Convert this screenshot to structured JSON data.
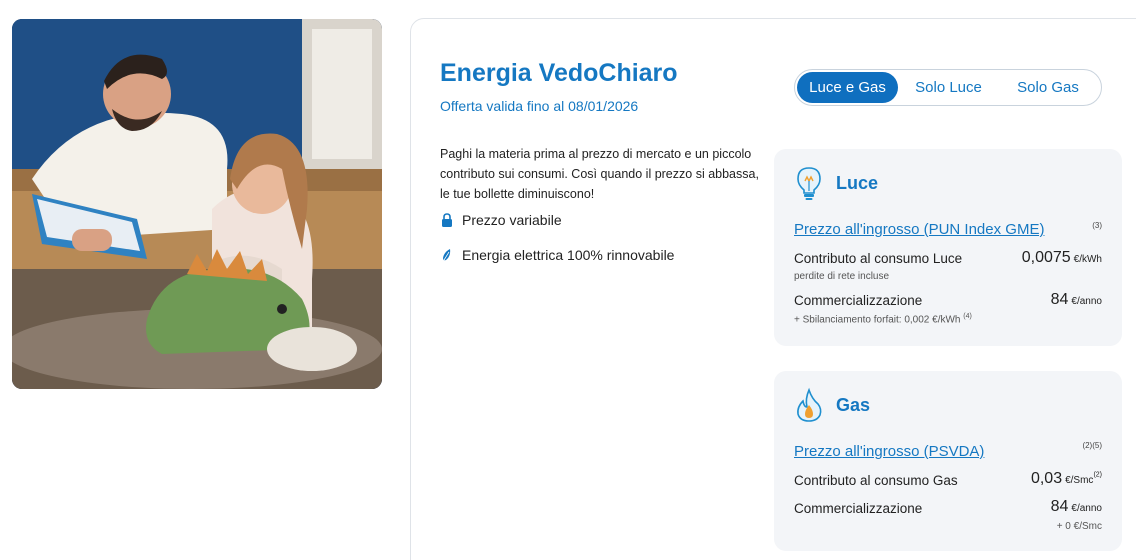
{
  "offer": {
    "title": "Energia VedoChiaro",
    "validity": "Offerta valida fino al 08/01/2026",
    "description": "Paghi la materia prima al prezzo di mercato e un piccolo contributo sui consumi. Così quando il prezzo si abbassa, le tue bollette diminuiscono!",
    "features": [
      {
        "icon": "lock-icon",
        "label": "Prezzo variabile"
      },
      {
        "icon": "leaf-icon",
        "label": "Energia elettrica 100% rinnovabile"
      }
    ]
  },
  "tabs": [
    {
      "label": "Luce e Gas",
      "selected": true
    },
    {
      "label": "Solo Luce",
      "selected": false
    },
    {
      "label": "Solo Gas",
      "selected": false
    }
  ],
  "luce": {
    "icon": "lightbulb-icon",
    "name": "Luce",
    "link": "Prezzo all'ingrosso (PUN Index GME)",
    "link_note": "(3)",
    "contributo_label": "Contributo al consumo Luce",
    "contributo_sub": "perdite di rete incluse",
    "contributo_value": "0,0075",
    "contributo_unit": "€/kWh",
    "comm_label": "Commercializzazione",
    "comm_sub": "+ Sbilanciamento forfait: 0,002 €/kWh",
    "comm_sub_note": "(4)",
    "comm_value": "84",
    "comm_unit": "€/anno"
  },
  "gas": {
    "icon": "flame-icon",
    "name": "Gas",
    "link": "Prezzo all'ingrosso (PSVDA)",
    "link_note": "(2)(5)",
    "contributo_label": "Contributo al consumo Gas",
    "contributo_value": "0,03",
    "contributo_unit": "€/Smc",
    "contributo_note": "(2)",
    "comm_label": "Commercializzazione",
    "comm_value": "84",
    "comm_unit": "€/anno",
    "comm_extra": "+ 0 €/Smc"
  },
  "colors": {
    "brand_blue": "#1578c2",
    "tab_active_bg": "#0f6fbf",
    "panel_bg": "#f3f5f8"
  }
}
